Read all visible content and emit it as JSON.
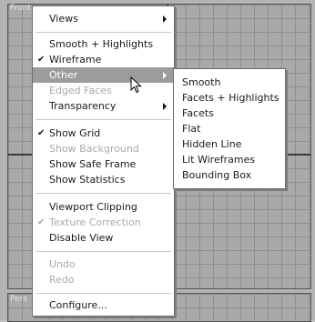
{
  "viewport": {
    "top_label": "Front",
    "bottom_label": "Pers"
  },
  "menu": {
    "items": [
      {
        "label": "Views",
        "checked": false,
        "disabled": false,
        "submenu": true
      },
      {
        "label": "Smooth + Highlights",
        "checked": false,
        "disabled": false,
        "submenu": false
      },
      {
        "label": "Wireframe",
        "checked": true,
        "disabled": false,
        "submenu": false
      },
      {
        "label": "Other",
        "checked": false,
        "disabled": false,
        "submenu": true,
        "highlighted": true
      },
      {
        "label": "Edged Faces",
        "checked": false,
        "disabled": true,
        "submenu": false
      },
      {
        "label": "Transparency",
        "checked": false,
        "disabled": false,
        "submenu": true
      },
      {
        "label": "Show Grid",
        "checked": true,
        "disabled": false,
        "submenu": false
      },
      {
        "label": "Show Background",
        "checked": false,
        "disabled": true,
        "submenu": false
      },
      {
        "label": "Show Safe Frame",
        "checked": false,
        "disabled": false,
        "submenu": false
      },
      {
        "label": "Show Statistics",
        "checked": false,
        "disabled": false,
        "submenu": false
      },
      {
        "label": "Viewport Clipping",
        "checked": false,
        "disabled": false,
        "submenu": false
      },
      {
        "label": "Texture Correction",
        "checked": true,
        "disabled": true,
        "submenu": false
      },
      {
        "label": "Disable View",
        "checked": false,
        "disabled": false,
        "submenu": false
      },
      {
        "label": "Undo",
        "checked": false,
        "disabled": true,
        "submenu": false
      },
      {
        "label": "Redo",
        "checked": false,
        "disabled": true,
        "submenu": false
      },
      {
        "label": "Configure...",
        "checked": false,
        "disabled": false,
        "submenu": false
      }
    ],
    "check_glyph": "✔"
  },
  "submenu": {
    "items": [
      "Smooth",
      "Facets + Highlights",
      "Facets",
      "Flat",
      "Hidden Line",
      "Lit Wireframes",
      "Bounding Box"
    ]
  },
  "colors": {
    "highlight": "#9c9c9c",
    "disabled_text": "#a9a9a9",
    "viewport_bg": "#a9a9a9"
  }
}
